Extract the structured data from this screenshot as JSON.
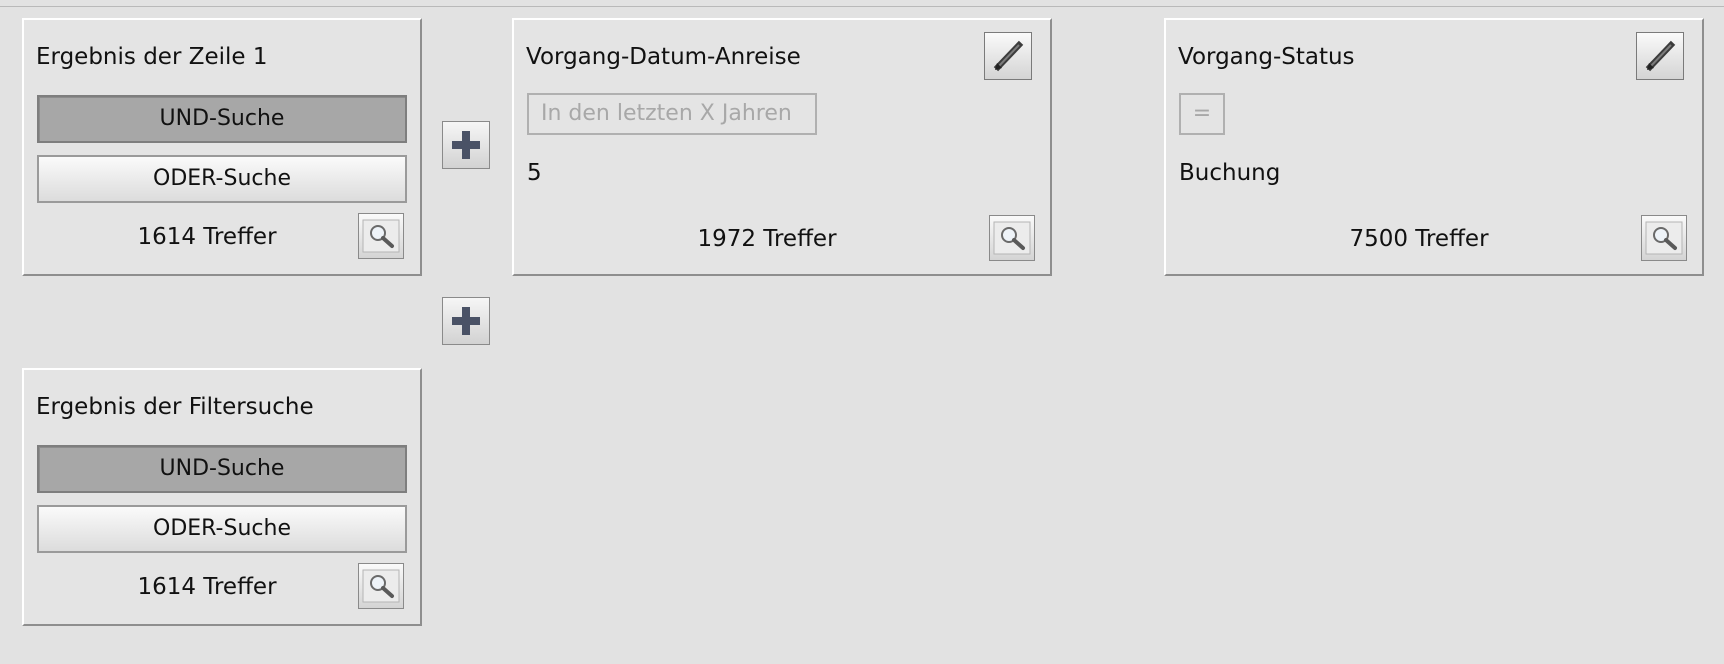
{
  "result_row1": {
    "title": "Ergebnis der Zeile 1",
    "and_label": "UND-Suche",
    "or_label": "ODER-Suche",
    "count": "1614 Treffer"
  },
  "filter_anreise": {
    "title": "Vorgang-Datum-Anreise",
    "operator": "In den letzten X Jahren",
    "value": "5",
    "count": "1972 Treffer"
  },
  "filter_status": {
    "title": "Vorgang-Status",
    "operator": "=",
    "value": "Buchung",
    "count": "7500 Treffer"
  },
  "result_filter": {
    "title": "Ergebnis der Filtersuche",
    "and_label": "UND-Suche",
    "or_label": "ODER-Suche",
    "count": "1614 Treffer"
  },
  "icons": {
    "add": "plus-icon",
    "edit": "pencil-icon",
    "search": "magnifier-icon"
  },
  "colors": {
    "background": "#e2e2e2",
    "pressed_button": "#a7a7a7",
    "disabled_text": "#a8a8a8"
  }
}
